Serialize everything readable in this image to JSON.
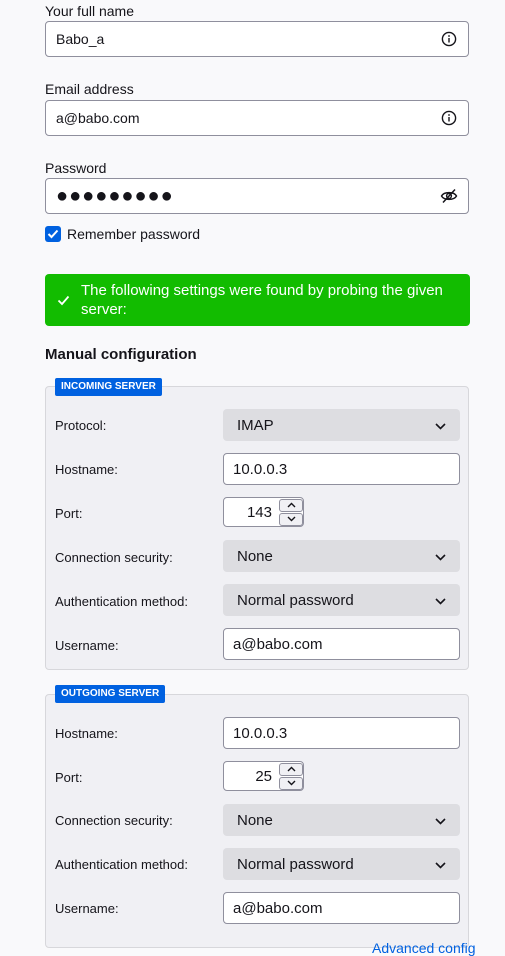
{
  "account": {
    "name_label": "Your full name",
    "name_value": "Babo_a",
    "email_label": "Email address",
    "email_value": "a@babo.com",
    "password_label": "Password",
    "password_value": "●●●●●●●●●",
    "remember_label": "Remember password",
    "remember_checked": true
  },
  "notice": {
    "text": "The following settings were found by probing the given server:",
    "color": "#12bc00"
  },
  "manual": {
    "title": "Manual configuration",
    "incoming": {
      "legend": "INCOMING SERVER",
      "protocol_label": "Protocol:",
      "protocol_value": "IMAP",
      "hostname_label": "Hostname:",
      "hostname_value": "10.0.0.3",
      "port_label": "Port:",
      "port_value": "143",
      "security_label": "Connection security:",
      "security_value": "None",
      "auth_label": "Authentication method:",
      "auth_value": "Normal password",
      "username_label": "Username:",
      "username_value": "a@babo.com"
    },
    "outgoing": {
      "legend": "OUTGOING SERVER",
      "hostname_label": "Hostname:",
      "hostname_value": "10.0.0.3",
      "port_label": "Port:",
      "port_value": "25",
      "security_label": "Connection security:",
      "security_value": "None",
      "auth_label": "Authentication method:",
      "auth_value": "Normal password",
      "username_label": "Username:",
      "username_value": "a@babo.com"
    }
  },
  "advanced_link": "Advanced config",
  "colors": {
    "accent": "#0061e0",
    "success": "#12bc00"
  },
  "icons": [
    "info-icon",
    "eye-slash-icon",
    "checkmark-icon",
    "chevron-down-icon",
    "chevron-up-icon"
  ]
}
